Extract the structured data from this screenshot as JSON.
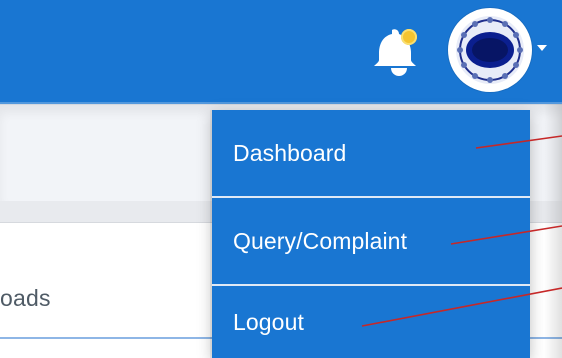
{
  "header": {
    "notification_icon": "bell-icon",
    "notification_dot_color": "#f4c430",
    "avatar_icon": "user-avatar-emblem",
    "caret_icon": "caret-down-icon"
  },
  "content": {
    "partial_tab_label": "oads"
  },
  "menu": {
    "items": [
      {
        "label": "Dashboard"
      },
      {
        "label": "Query/Complaint"
      },
      {
        "label": "Logout"
      }
    ]
  },
  "colors": {
    "primary": "#1976d2",
    "annotation": "#c62828"
  }
}
